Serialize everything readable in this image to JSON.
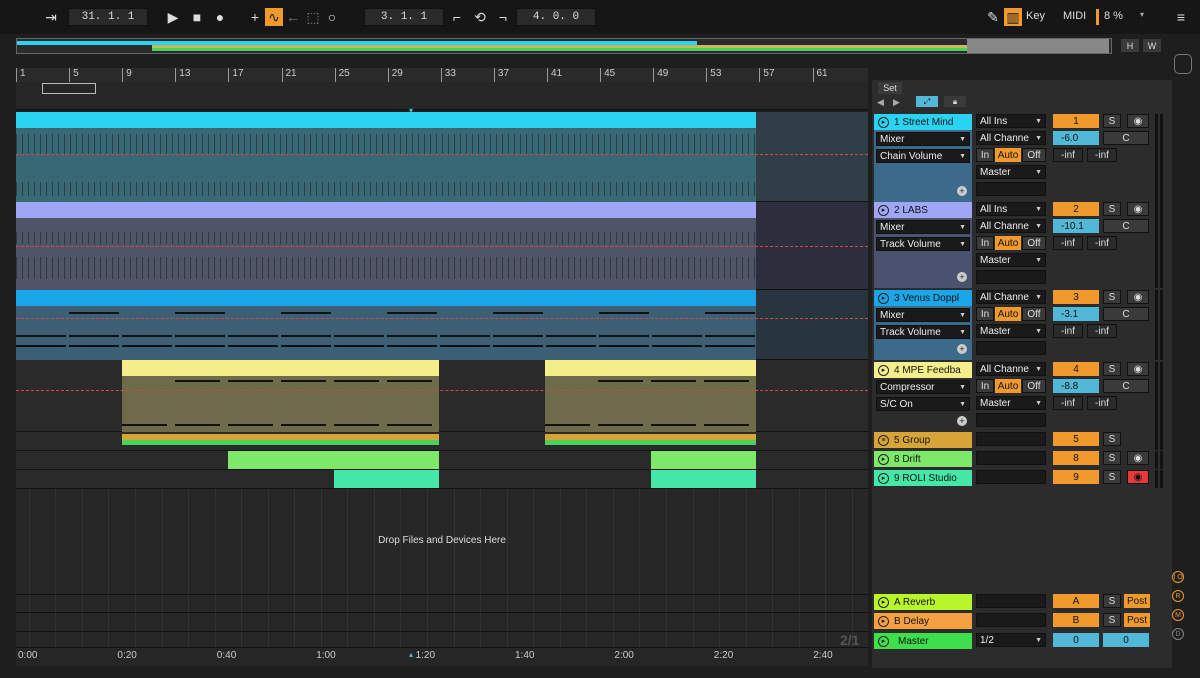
{
  "transport": {
    "position": "31. 1. 1",
    "loop_start": "3. 1. 1",
    "loop_length": "4. 0. 0",
    "key_label": "Key",
    "midi_label": "MIDI",
    "cpu": "8 %"
  },
  "overview_buttons": {
    "h": "H",
    "w": "W"
  },
  "ruler": [
    "1",
    "5",
    "9",
    "13",
    "17",
    "21",
    "25",
    "29",
    "33",
    "37",
    "41",
    "45",
    "49",
    "53",
    "57",
    "61"
  ],
  "time_ruler": [
    "0:00",
    "0:20",
    "0:40",
    "1:00",
    "1:20",
    "1:40",
    "2:00",
    "2:20",
    "2:40"
  ],
  "set_label": "Set",
  "drop_text": "Drop Files and Devices Here",
  "time_sig": "2/1",
  "tracks": [
    {
      "num": "1",
      "name": "1 Street Mind",
      "color": "#2bd3f2",
      "input": "All Ins",
      "device": "Mixer",
      "param": "Chain Volume",
      "channel": "All Channe",
      "in": "In",
      "auto": "Auto",
      "off": "Off",
      "output": "Master",
      "volume": "-6.0",
      "pan": "C",
      "peak_l": "-inf",
      "peak_r": "-inf",
      "s": "S"
    },
    {
      "num": "2",
      "name": "2 LABS",
      "color": "#9fa7f5",
      "input": "All Ins",
      "device": "Mixer",
      "param": "Track Volume",
      "channel": "All Channe",
      "in": "In",
      "auto": "Auto",
      "off": "Off",
      "output": "Master",
      "volume": "-10.1",
      "pan": "C",
      "peak_l": "-inf",
      "peak_r": "-inf",
      "s": "S"
    },
    {
      "num": "3",
      "name": "3 Venus Doppl",
      "color": "#1aa6e8",
      "input": "All Channe",
      "device": "Mixer",
      "param": "Track Volume",
      "channel": "",
      "in": "In",
      "auto": "Auto",
      "off": "Off",
      "output": "Master",
      "volume": "-3.1",
      "pan": "C",
      "peak_l": "-inf",
      "peak_r": "-inf",
      "s": "S"
    },
    {
      "num": "4",
      "name": "4 MPE Feedba",
      "color": "#f4ef8a",
      "input": "All Channe",
      "device": "Compressor",
      "param": "S/C On",
      "channel": "",
      "in": "In",
      "auto": "Auto",
      "off": "Off",
      "output": "Master",
      "volume": "-8.8",
      "pan": "C",
      "peak_l": "-inf",
      "peak_r": "-inf",
      "s": "S"
    },
    {
      "num": "5",
      "name": "5 Group",
      "color": "#d7a537",
      "s": "S"
    },
    {
      "num": "8",
      "name": "8 Drift",
      "color": "#7ee86a",
      "s": "S"
    },
    {
      "num": "9",
      "name": "9 ROLI Studio",
      "color": "#45e7a8",
      "s": "S"
    }
  ],
  "returns": [
    {
      "name": "A Reverb",
      "num": "A",
      "color": "#b9f52b",
      "s": "S",
      "post": "Post"
    },
    {
      "name": "B Delay",
      "num": "B",
      "color": "#f5a142",
      "s": "S",
      "post": "Post"
    }
  ],
  "master": {
    "name": "Master",
    "color": "#3de04a",
    "output": "1/2",
    "vol": "0",
    "pan": "0"
  },
  "side_buttons": [
    "I O",
    "R",
    "M",
    "D"
  ]
}
